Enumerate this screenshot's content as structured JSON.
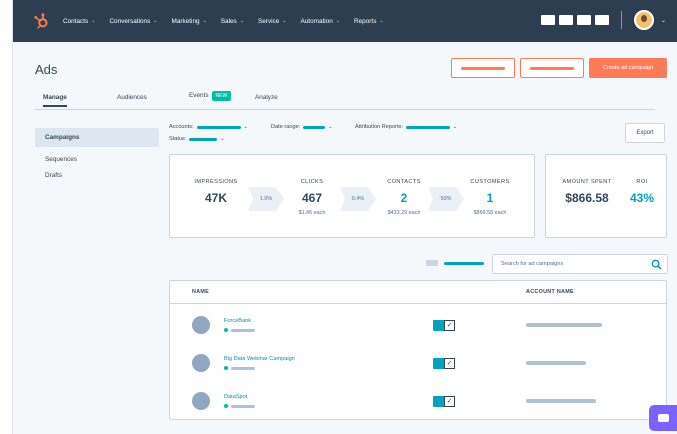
{
  "topnav": {
    "items": [
      {
        "label": "Contacts"
      },
      {
        "label": "Conversations"
      },
      {
        "label": "Marketing"
      },
      {
        "label": "Sales"
      },
      {
        "label": "Service"
      },
      {
        "label": "Automation"
      },
      {
        "label": "Reports"
      }
    ]
  },
  "header": {
    "title": "Ads",
    "create_label": "Create ad campaign"
  },
  "tabs": [
    {
      "label": "Manage",
      "active": true
    },
    {
      "label": "Audiences"
    },
    {
      "label": "Events",
      "badge": "NEW"
    },
    {
      "label": "Analyze"
    }
  ],
  "sidebar": {
    "items": [
      {
        "label": "Campaigns",
        "active": true
      },
      {
        "label": "Sequences"
      },
      {
        "label": "Drafts"
      }
    ]
  },
  "filters": {
    "accounts_label": "Accounts:",
    "date_range_label": "Date range:",
    "attribution_label": "Attribution Reports:",
    "status_label": "Status:",
    "export_label": "Export"
  },
  "funnel": {
    "impressions": {
      "label": "IMPRESSIONS",
      "value": "47K"
    },
    "conv1": "1.0%",
    "clicks": {
      "label": "CLICKS",
      "value": "467",
      "sub": "$1.86 each"
    },
    "conv2": "0.4%",
    "contacts": {
      "label": "CONTACTS",
      "value": "2",
      "sub": "$433.29 each"
    },
    "conv3": "50%",
    "customers": {
      "label": "CUSTOMERS",
      "value": "1",
      "sub": "$866.58 each"
    }
  },
  "spend": {
    "amount_label": "AMOUNT SPENT",
    "amount_value": "$866.58",
    "roi_label": "ROI",
    "roi_value": "43%"
  },
  "search": {
    "placeholder": "Search for ad campaigns"
  },
  "table": {
    "headers": {
      "name": "NAME",
      "account": "ACCOUNT NAME"
    },
    "rows": [
      {
        "name": "ForceBank"
      },
      {
        "name": "Big Data Webinar Campaign"
      },
      {
        "name": "DataSpot"
      }
    ]
  },
  "colors": {
    "nav_bg": "#2d3e50",
    "accent_orange": "#ff7a59",
    "teal": "#00a4bd",
    "chat": "#7b61ff"
  }
}
